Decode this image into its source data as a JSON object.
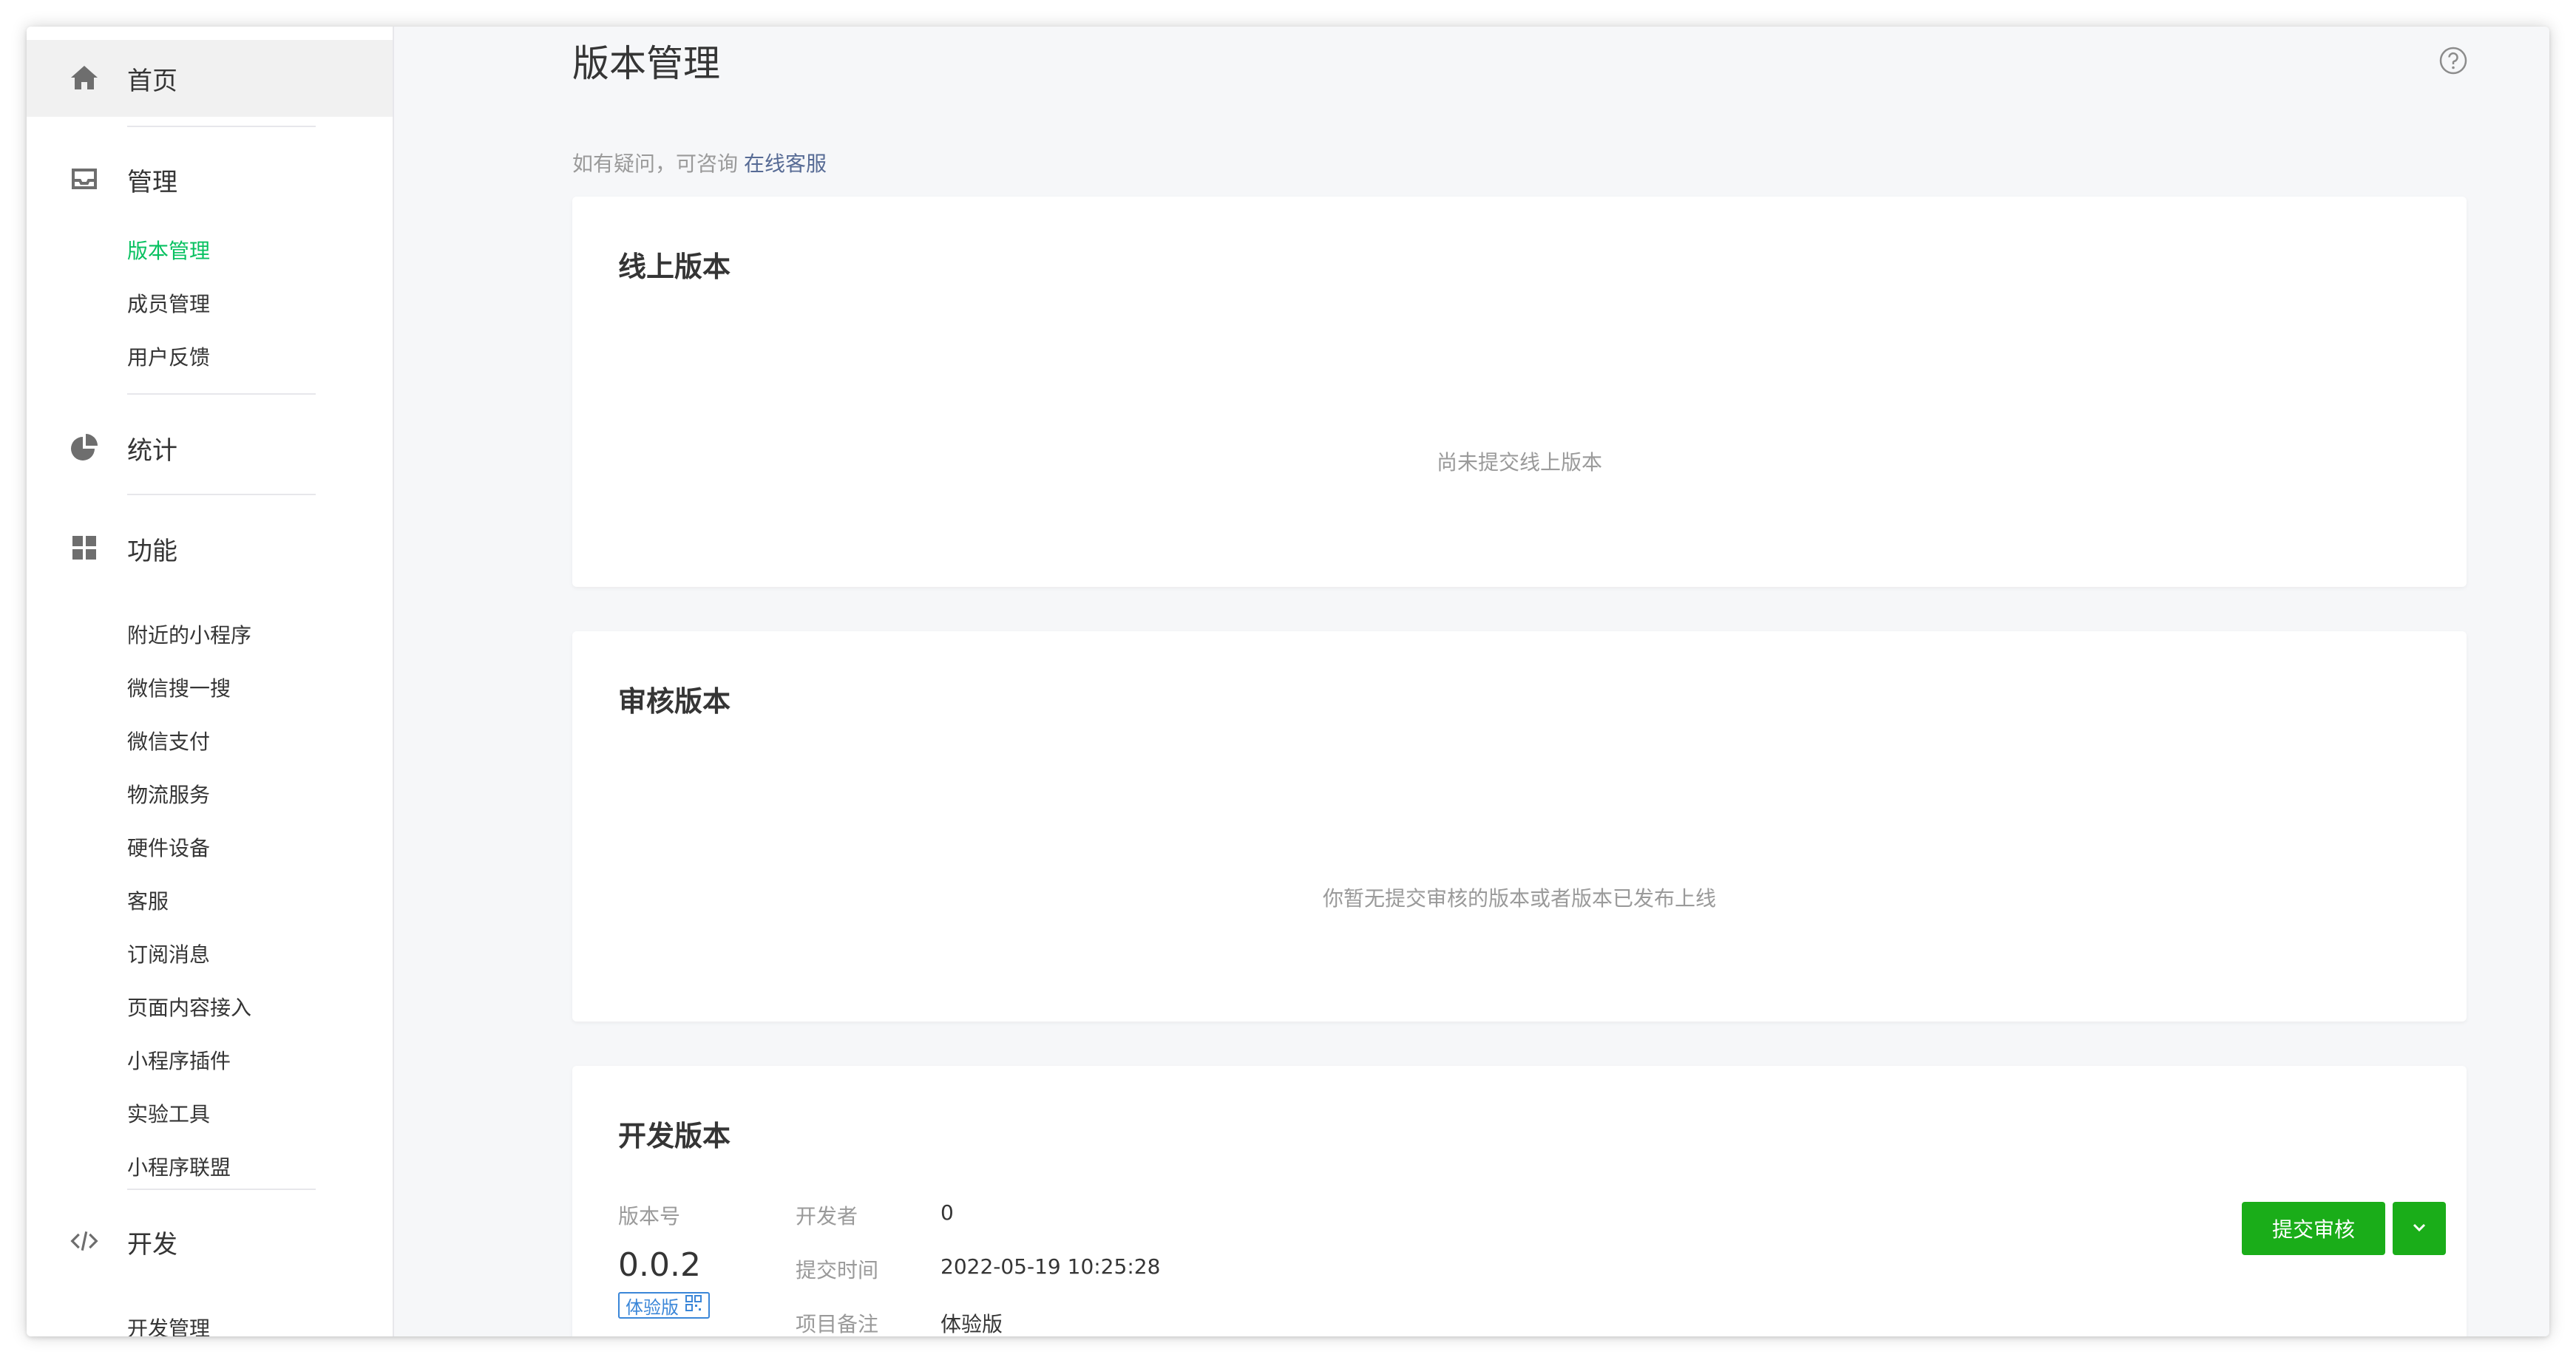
{
  "sidebar": {
    "home": {
      "label": "首页",
      "icon": "home-icon"
    },
    "manage": {
      "label": "管理",
      "icon": "inbox-icon",
      "items": [
        "版本管理",
        "成员管理",
        "用户反馈"
      ]
    },
    "stats": {
      "label": "统计",
      "icon": "pie-chart-icon"
    },
    "features": {
      "label": "功能",
      "icon": "grid-icon",
      "items": [
        "附近的小程序",
        "微信搜一搜",
        "微信支付",
        "物流服务",
        "硬件设备",
        "客服",
        "订阅消息",
        "页面内容接入",
        "小程序插件",
        "实验工具",
        "小程序联盟"
      ]
    },
    "dev": {
      "label": "开发",
      "icon": "code-icon",
      "items": [
        "开发管理"
      ]
    }
  },
  "page": {
    "title": "版本管理",
    "notice_text": "如有疑问，可咨询",
    "notice_link": "在线客服"
  },
  "online_version": {
    "title": "线上版本",
    "empty_text": "尚未提交线上版本"
  },
  "review_version": {
    "title": "审核版本",
    "empty_text": "你暂无提交审核的版本或者版本已发布上线"
  },
  "dev_version": {
    "title": "开发版本",
    "version_label": "版本号",
    "version": "0.0.2",
    "tag": "体验版",
    "developer_label": "开发者",
    "developer": "0",
    "submit_time_label": "提交时间",
    "submit_time": "2022-05-19 10:25:28",
    "note_label": "项目备注",
    "note": "体验版",
    "submit_button": "提交审核"
  },
  "colors": {
    "accent_green": "#07c160",
    "button_green": "#1aad19",
    "link_blue": "#576b95",
    "tag_blue": "#3a86d8"
  }
}
